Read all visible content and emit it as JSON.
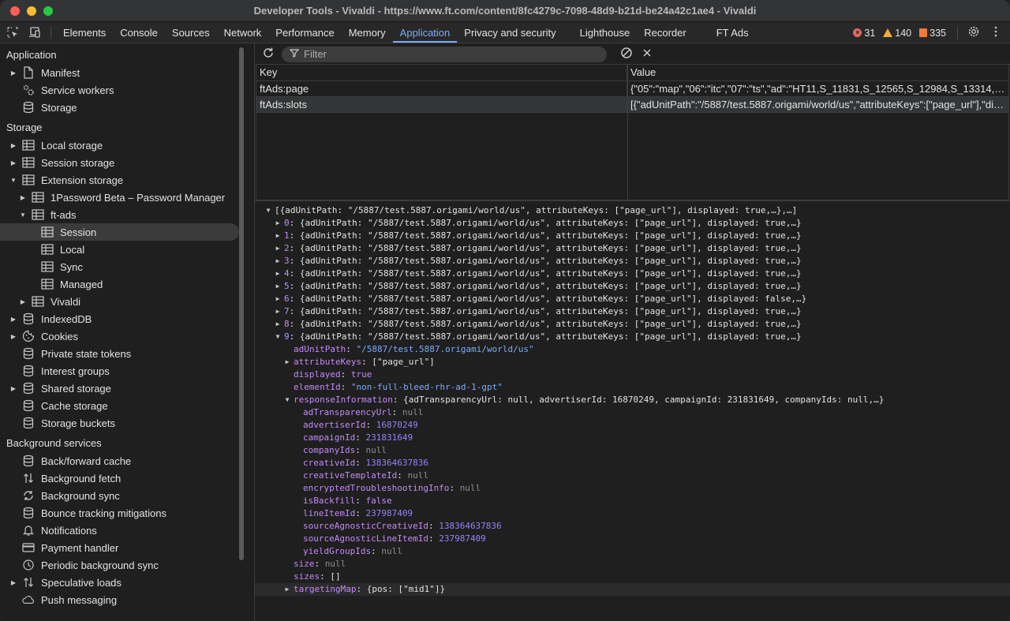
{
  "window": {
    "title": "Developer Tools - Vivaldi - https://www.ft.com/content/8fc4279c-7098-48d9-b21d-be24a42c1ae4 - Vivaldi",
    "traffic_lights": [
      "#ff5f57",
      "#febc2e",
      "#28c840"
    ]
  },
  "toolbar": {
    "tabs": [
      "Elements",
      "Console",
      "Sources",
      "Network",
      "Performance",
      "Memory",
      "Application",
      "Privacy and security",
      "Lighthouse",
      "Recorder",
      "FT Ads"
    ],
    "active_tab": "Application",
    "errors": "31",
    "warnings": "140",
    "issues": "335"
  },
  "sidebar": {
    "sections": [
      {
        "title": "Application",
        "items": [
          {
            "label": "Manifest",
            "icon": "file-icon",
            "arrow": "right",
            "indent": 0
          },
          {
            "label": "Service workers",
            "icon": "gears-icon",
            "arrow": "",
            "indent": 0
          },
          {
            "label": "Storage",
            "icon": "database-icon",
            "arrow": "",
            "indent": 0
          }
        ]
      },
      {
        "title": "Storage",
        "items": [
          {
            "label": "Local storage",
            "icon": "table-icon",
            "arrow": "right",
            "indent": 0
          },
          {
            "label": "Session storage",
            "icon": "table-icon",
            "arrow": "right",
            "indent": 0
          },
          {
            "label": "Extension storage",
            "icon": "table-icon",
            "arrow": "down",
            "indent": 0
          },
          {
            "label": "1Password Beta – Password Manager",
            "icon": "table-icon",
            "arrow": "right",
            "indent": 1
          },
          {
            "label": "ft-ads",
            "icon": "table-icon",
            "arrow": "down",
            "indent": 1
          },
          {
            "label": "Session",
            "icon": "table-icon",
            "arrow": "",
            "indent": 2,
            "selected": true
          },
          {
            "label": "Local",
            "icon": "table-icon",
            "arrow": "",
            "indent": 2
          },
          {
            "label": "Sync",
            "icon": "table-icon",
            "arrow": "",
            "indent": 2
          },
          {
            "label": "Managed",
            "icon": "table-icon",
            "arrow": "",
            "indent": 2
          },
          {
            "label": "Vivaldi",
            "icon": "table-icon",
            "arrow": "right",
            "indent": 1
          },
          {
            "label": "IndexedDB",
            "icon": "database-icon",
            "arrow": "right",
            "indent": 0
          },
          {
            "label": "Cookies",
            "icon": "cookie-icon",
            "arrow": "right",
            "indent": 0
          },
          {
            "label": "Private state tokens",
            "icon": "database-icon",
            "arrow": "",
            "indent": 0
          },
          {
            "label": "Interest groups",
            "icon": "database-icon",
            "arrow": "",
            "indent": 0
          },
          {
            "label": "Shared storage",
            "icon": "database-icon",
            "arrow": "right",
            "indent": 0
          },
          {
            "label": "Cache storage",
            "icon": "database-icon",
            "arrow": "",
            "indent": 0
          },
          {
            "label": "Storage buckets",
            "icon": "database-icon",
            "arrow": "",
            "indent": 0
          }
        ]
      },
      {
        "title": "Background services",
        "items": [
          {
            "label": "Back/forward cache",
            "icon": "database-icon",
            "arrow": "",
            "indent": 0
          },
          {
            "label": "Background fetch",
            "icon": "arrows-updown-icon",
            "arrow": "",
            "indent": 0
          },
          {
            "label": "Background sync",
            "icon": "sync-icon",
            "arrow": "",
            "indent": 0
          },
          {
            "label": "Bounce tracking mitigations",
            "icon": "database-icon",
            "arrow": "",
            "indent": 0
          },
          {
            "label": "Notifications",
            "icon": "bell-icon",
            "arrow": "",
            "indent": 0
          },
          {
            "label": "Payment handler",
            "icon": "card-icon",
            "arrow": "",
            "indent": 0
          },
          {
            "label": "Periodic background sync",
            "icon": "clock-icon",
            "arrow": "",
            "indent": 0
          },
          {
            "label": "Speculative loads",
            "icon": "arrows-updown-icon",
            "arrow": "right",
            "indent": 0
          },
          {
            "label": "Push messaging",
            "icon": "cloud-icon",
            "arrow": "",
            "indent": 0
          }
        ]
      }
    ]
  },
  "filter": {
    "placeholder": "Filter"
  },
  "table": {
    "headers": [
      "Key",
      "Value"
    ],
    "rows": [
      {
        "key": "ftAds:page",
        "value": "{\"05\":\"map\",\"06\":\"itc\",\"07\":\"ts\",\"ad\":\"HT11,S_11831,S_12565,S_12984,S_13314,S_13..."
      },
      {
        "key": "ftAds:slots",
        "value": "[{\"adUnitPath\":\"/5887/test.5887.origami/world/us\",\"attributeKeys\":[\"page_url\"],\"displayed\":..."
      }
    ],
    "selected_row": 1
  },
  "preview": {
    "lines": [
      {
        "indent": 0,
        "tri": "down",
        "parts": [
          [
            "p",
            "[{adUnitPath: \"/5887/test.5887.origami/world/us\", attributeKeys: [\"page_url\"], displayed: true,…},…]"
          ]
        ]
      },
      {
        "indent": 1,
        "tri": "right",
        "parts": [
          [
            "k",
            "0"
          ],
          [
            "p",
            ": {adUnitPath: \"/5887/test.5887.origami/world/us\", attributeKeys: [\"page_url\"], displayed: true,…}"
          ]
        ]
      },
      {
        "indent": 1,
        "tri": "right",
        "parts": [
          [
            "k",
            "1"
          ],
          [
            "p",
            ": {adUnitPath: \"/5887/test.5887.origami/world/us\", attributeKeys: [\"page_url\"], displayed: true,…}"
          ]
        ]
      },
      {
        "indent": 1,
        "tri": "right",
        "parts": [
          [
            "k",
            "2"
          ],
          [
            "p",
            ": {adUnitPath: \"/5887/test.5887.origami/world/us\", attributeKeys: [\"page_url\"], displayed: true,…}"
          ]
        ]
      },
      {
        "indent": 1,
        "tri": "right",
        "parts": [
          [
            "k",
            "3"
          ],
          [
            "p",
            ": {adUnitPath: \"/5887/test.5887.origami/world/us\", attributeKeys: [\"page_url\"], displayed: true,…}"
          ]
        ]
      },
      {
        "indent": 1,
        "tri": "right",
        "parts": [
          [
            "k",
            "4"
          ],
          [
            "p",
            ": {adUnitPath: \"/5887/test.5887.origami/world/us\", attributeKeys: [\"page_url\"], displayed: true,…}"
          ]
        ]
      },
      {
        "indent": 1,
        "tri": "right",
        "parts": [
          [
            "k",
            "5"
          ],
          [
            "p",
            ": {adUnitPath: \"/5887/test.5887.origami/world/us\", attributeKeys: [\"page_url\"], displayed: true,…}"
          ]
        ]
      },
      {
        "indent": 1,
        "tri": "right",
        "parts": [
          [
            "k",
            "6"
          ],
          [
            "p",
            ": {adUnitPath: \"/5887/test.5887.origami/world/us\", attributeKeys: [\"page_url\"], displayed: false,…}"
          ]
        ]
      },
      {
        "indent": 1,
        "tri": "right",
        "parts": [
          [
            "k",
            "7"
          ],
          [
            "p",
            ": {adUnitPath: \"/5887/test.5887.origami/world/us\", attributeKeys: [\"page_url\"], displayed: true,…}"
          ]
        ]
      },
      {
        "indent": 1,
        "tri": "right",
        "parts": [
          [
            "k",
            "8"
          ],
          [
            "p",
            ": {adUnitPath: \"/5887/test.5887.origami/world/us\", attributeKeys: [\"page_url\"], displayed: true,…}"
          ]
        ]
      },
      {
        "indent": 1,
        "tri": "down",
        "parts": [
          [
            "k",
            "9"
          ],
          [
            "p",
            ": {adUnitPath: \"/5887/test.5887.origami/world/us\", attributeKeys: [\"page_url\"], displayed: true,…}"
          ]
        ]
      },
      {
        "indent": 2,
        "tri": "",
        "parts": [
          [
            "k",
            "adUnitPath"
          ],
          [
            "p",
            ": "
          ],
          [
            "s",
            "\"/5887/test.5887.origami/world/us\""
          ]
        ]
      },
      {
        "indent": 2,
        "tri": "right",
        "parts": [
          [
            "k",
            "attributeKeys"
          ],
          [
            "p",
            ": [\"page_url\"]"
          ]
        ]
      },
      {
        "indent": 2,
        "tri": "",
        "parts": [
          [
            "k",
            "displayed"
          ],
          [
            "p",
            ": "
          ],
          [
            "b",
            "true"
          ]
        ]
      },
      {
        "indent": 2,
        "tri": "",
        "parts": [
          [
            "k",
            "elementId"
          ],
          [
            "p",
            ": "
          ],
          [
            "s",
            "\"non-full-bleed-rhr-ad-1-gpt\""
          ]
        ]
      },
      {
        "indent": 2,
        "tri": "down",
        "parts": [
          [
            "k",
            "responseInformation"
          ],
          [
            "p",
            ": {adTransparencyUrl: null, advertiserId: 16870249, campaignId: 231831649, companyIds: null,…}"
          ]
        ]
      },
      {
        "indent": 3,
        "tri": "",
        "parts": [
          [
            "k",
            "adTransparencyUrl"
          ],
          [
            "p",
            ": "
          ],
          [
            "nl",
            "null"
          ]
        ]
      },
      {
        "indent": 3,
        "tri": "",
        "parts": [
          [
            "k",
            "advertiserId"
          ],
          [
            "p",
            ": "
          ],
          [
            "n",
            "16870249"
          ]
        ]
      },
      {
        "indent": 3,
        "tri": "",
        "parts": [
          [
            "k",
            "campaignId"
          ],
          [
            "p",
            ": "
          ],
          [
            "n",
            "231831649"
          ]
        ]
      },
      {
        "indent": 3,
        "tri": "",
        "parts": [
          [
            "k",
            "companyIds"
          ],
          [
            "p",
            ": "
          ],
          [
            "nl",
            "null"
          ]
        ]
      },
      {
        "indent": 3,
        "tri": "",
        "parts": [
          [
            "k",
            "creativeId"
          ],
          [
            "p",
            ": "
          ],
          [
            "n",
            "138364637836"
          ]
        ]
      },
      {
        "indent": 3,
        "tri": "",
        "parts": [
          [
            "k",
            "creativeTemplateId"
          ],
          [
            "p",
            ": "
          ],
          [
            "nl",
            "null"
          ]
        ]
      },
      {
        "indent": 3,
        "tri": "",
        "parts": [
          [
            "k",
            "encryptedTroubleshootingInfo"
          ],
          [
            "p",
            ": "
          ],
          [
            "nl",
            "null"
          ]
        ]
      },
      {
        "indent": 3,
        "tri": "",
        "parts": [
          [
            "k",
            "isBackfill"
          ],
          [
            "p",
            ": "
          ],
          [
            "b",
            "false"
          ]
        ]
      },
      {
        "indent": 3,
        "tri": "",
        "parts": [
          [
            "k",
            "lineItemId"
          ],
          [
            "p",
            ": "
          ],
          [
            "n",
            "237987409"
          ]
        ]
      },
      {
        "indent": 3,
        "tri": "",
        "parts": [
          [
            "k",
            "sourceAgnosticCreativeId"
          ],
          [
            "p",
            ": "
          ],
          [
            "n",
            "138364637836"
          ]
        ]
      },
      {
        "indent": 3,
        "tri": "",
        "parts": [
          [
            "k",
            "sourceAgnosticLineItemId"
          ],
          [
            "p",
            ": "
          ],
          [
            "n",
            "237987409"
          ]
        ]
      },
      {
        "indent": 3,
        "tri": "",
        "parts": [
          [
            "k",
            "yieldGroupIds"
          ],
          [
            "p",
            ": "
          ],
          [
            "nl",
            "null"
          ]
        ]
      },
      {
        "indent": 2,
        "tri": "",
        "parts": [
          [
            "k",
            "size"
          ],
          [
            "p",
            ": "
          ],
          [
            "nl",
            "null"
          ]
        ]
      },
      {
        "indent": 2,
        "tri": "",
        "parts": [
          [
            "k",
            "sizes"
          ],
          [
            "p",
            ": []"
          ]
        ]
      },
      {
        "indent": 2,
        "tri": "right",
        "hl": true,
        "parts": [
          [
            "k",
            "targetingMap"
          ],
          [
            "p",
            ": {pos: [\"mid1\"]}"
          ]
        ]
      }
    ]
  }
}
